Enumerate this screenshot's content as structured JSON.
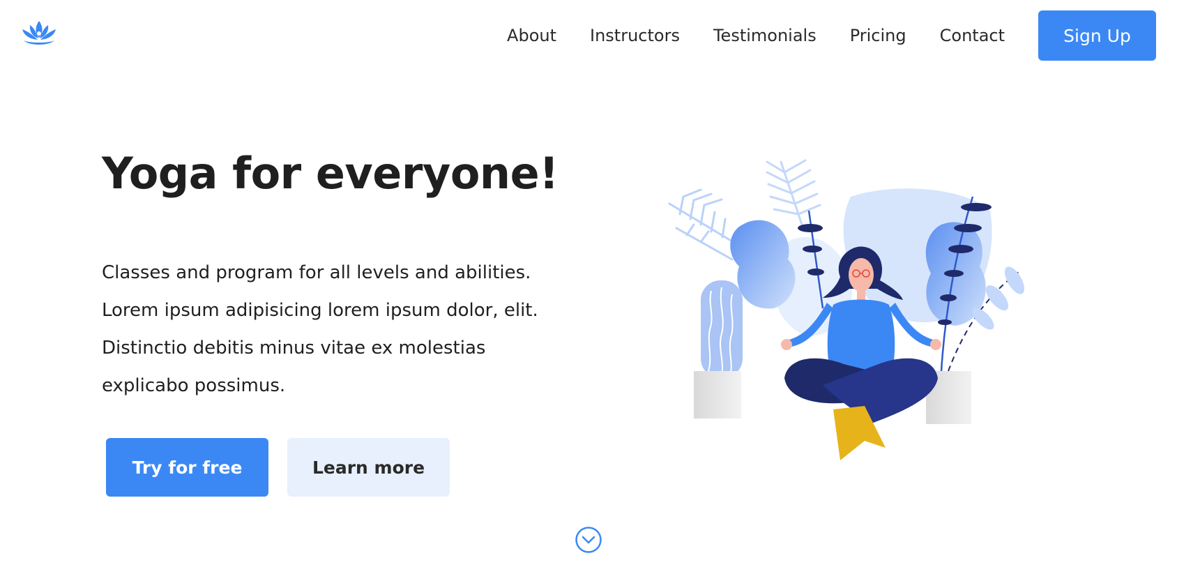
{
  "nav": {
    "logo": "lotus-logo-icon",
    "links": [
      "About",
      "Instructors",
      "Testimonials",
      "Pricing",
      "Contact"
    ],
    "signup_label": "Sign Up"
  },
  "hero": {
    "title": "Yoga for everyone!",
    "description_lines": [
      "Classes and program for all levels and abilities.",
      "Lorem ipsum adipisicing lorem ipsum dolor, elit.",
      "Distinctio debitis minus vitae ex molestias",
      "explicabo possimus."
    ],
    "primary_button": "Try for free",
    "secondary_button": "Learn more",
    "scroll_icon": "chevron-down-circle-icon",
    "illustration": "meditating-woman-illustration"
  },
  "colors": {
    "accent": "#3b88f5",
    "accent_light": "#e8f0fd",
    "navy": "#1f2a6b",
    "mustard": "#e6b31a"
  }
}
